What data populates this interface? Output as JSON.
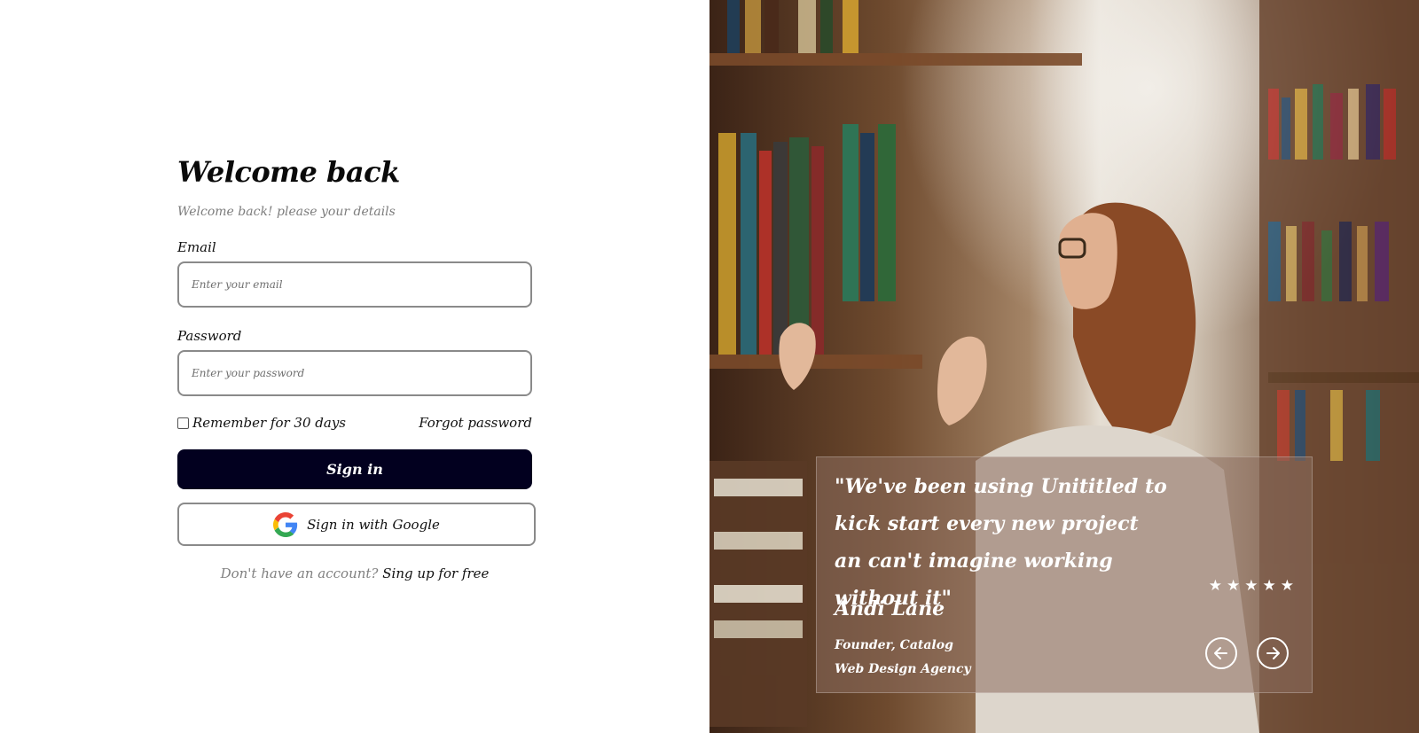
{
  "login": {
    "title": "Welcome back",
    "subtitle": "Welcome back! please your details",
    "email_label": "Email",
    "email_placeholder": "Enter your email",
    "password_label": "Password",
    "password_placeholder": "Enter your password",
    "remember_label": "Remember for 30 days",
    "remember_checked": false,
    "forgot_label": "Forgot password",
    "signin_label": "Sign in",
    "google_label": "Sign in with Google",
    "signup_prompt": "Don't have an account?",
    "signup_link": "Sing up for free"
  },
  "testimonial": {
    "quote": "\"We've been using Unititled to kick start every new project an can't imagine working without it\"",
    "rating": 5,
    "name": "Andi Lane",
    "role_line1": "Founder, Catalog",
    "role_line2": "Web Design Agency",
    "prev_icon": "arrow-left-circle-icon",
    "next_icon": "arrow-right-circle-icon"
  },
  "colors": {
    "primary_button": "#02001f",
    "muted_text": "#7d7d7d",
    "border": "#8a8a8a"
  }
}
